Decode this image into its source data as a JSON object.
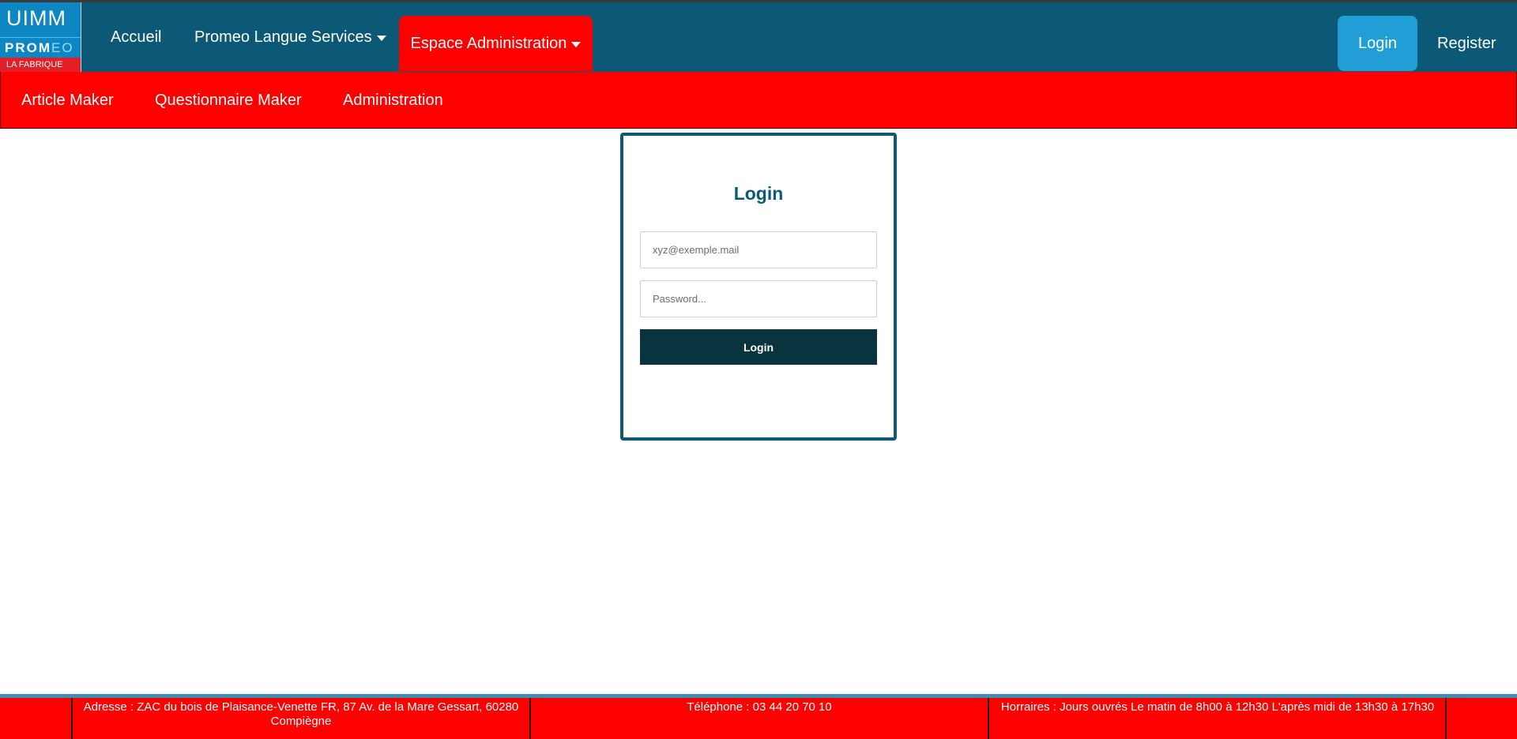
{
  "logo": {
    "line1": "UIMM",
    "line2_bold": "PROM",
    "line2_light": "EO",
    "line3": "LA FABRIQUE"
  },
  "nav": {
    "accueil": "Accueil",
    "promeo_langue": "Promeo Langue Services",
    "espace_admin": "Espace Administration",
    "login": "Login",
    "register": "Register"
  },
  "subnav": {
    "items": [
      "Article Maker",
      "Questionnaire Maker",
      "Administration"
    ]
  },
  "login_form": {
    "title": "Login",
    "email_placeholder": "xyz@exemple.mail",
    "password_placeholder": "Password...",
    "submit_label": "Login"
  },
  "footer": {
    "address": "Adresse : ZAC du bois de Plaisance-Venette FR, 87 Av. de la Mare Gessart, 60280 Compiègne",
    "phone": "Téléphone : 03 44 20 70 10",
    "hours": "Horraires : Jours ouvrés Le matin de 8h00 à 12h30 L'après midi de 13h30 à 17h30"
  },
  "colors": {
    "navbar": "#0b5877",
    "accent_red": "#ff0000",
    "login_blue": "#229ed6",
    "button_dark": "#07343e"
  }
}
